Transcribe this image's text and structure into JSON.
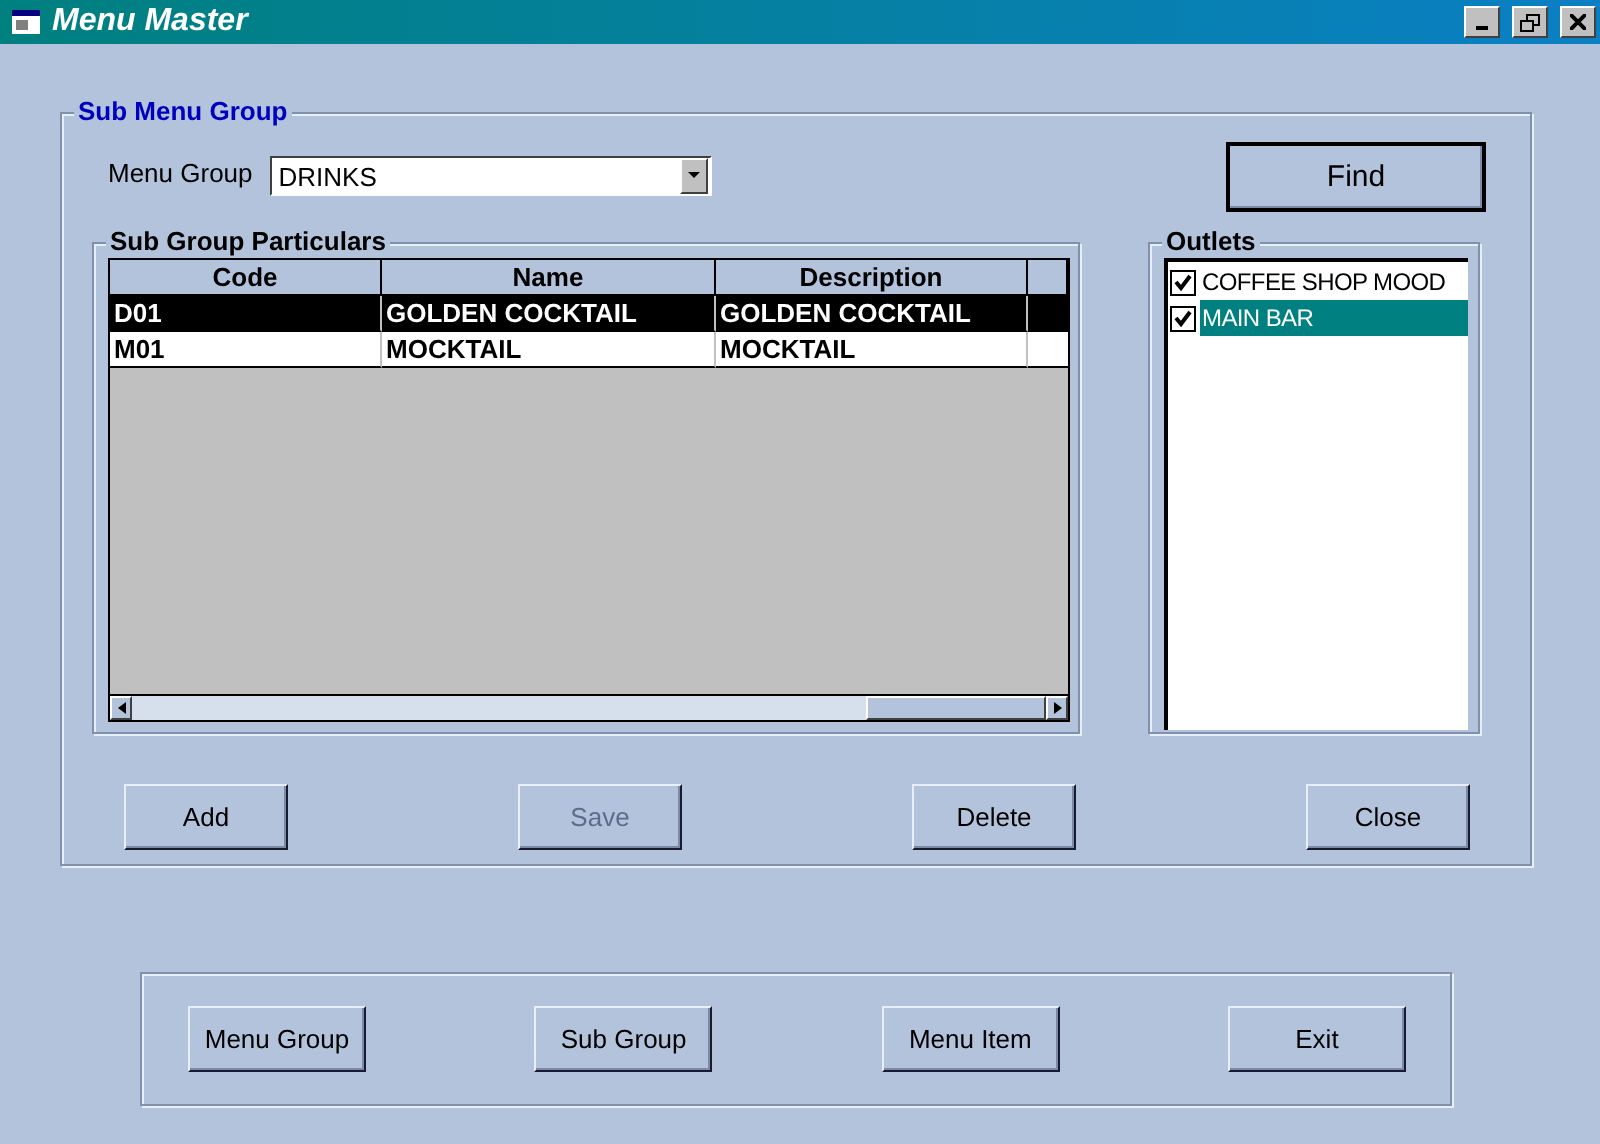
{
  "window": {
    "title": "Menu Master"
  },
  "frame": {
    "title": "Sub Menu Group",
    "menu_group": {
      "label": "Menu Group",
      "value": "DRINKS"
    },
    "find_button": {
      "label": "Find",
      "default": true
    },
    "particulars": {
      "title": "Sub Group Particulars",
      "columns": [
        "Code",
        "Name",
        "Description"
      ],
      "rows": [
        {
          "cells": [
            "D01",
            "GOLDEN COCKTAIL",
            "GOLDEN COCKTAIL"
          ],
          "selected": true
        },
        {
          "cells": [
            "M01",
            "MOCKTAIL",
            "MOCKTAIL"
          ],
          "selected": false
        }
      ]
    },
    "outlets": {
      "title": "Outlets",
      "items": [
        {
          "label": "COFFEE SHOP MOOD",
          "checked": true,
          "selected": false
        },
        {
          "label": "MAIN BAR",
          "checked": true,
          "selected": true
        }
      ]
    },
    "buttons": [
      {
        "label": "Add",
        "disabled": false
      },
      {
        "label": "Save",
        "disabled": true
      },
      {
        "label": "Delete",
        "disabled": false
      },
      {
        "label": "Close",
        "disabled": false
      }
    ]
  },
  "nav_buttons": [
    {
      "label": "Menu Group",
      "disabled": false
    },
    {
      "label": "Sub Group",
      "disabled": false
    },
    {
      "label": "Menu Item",
      "disabled": false
    },
    {
      "label": "Exit",
      "disabled": false
    }
  ]
}
